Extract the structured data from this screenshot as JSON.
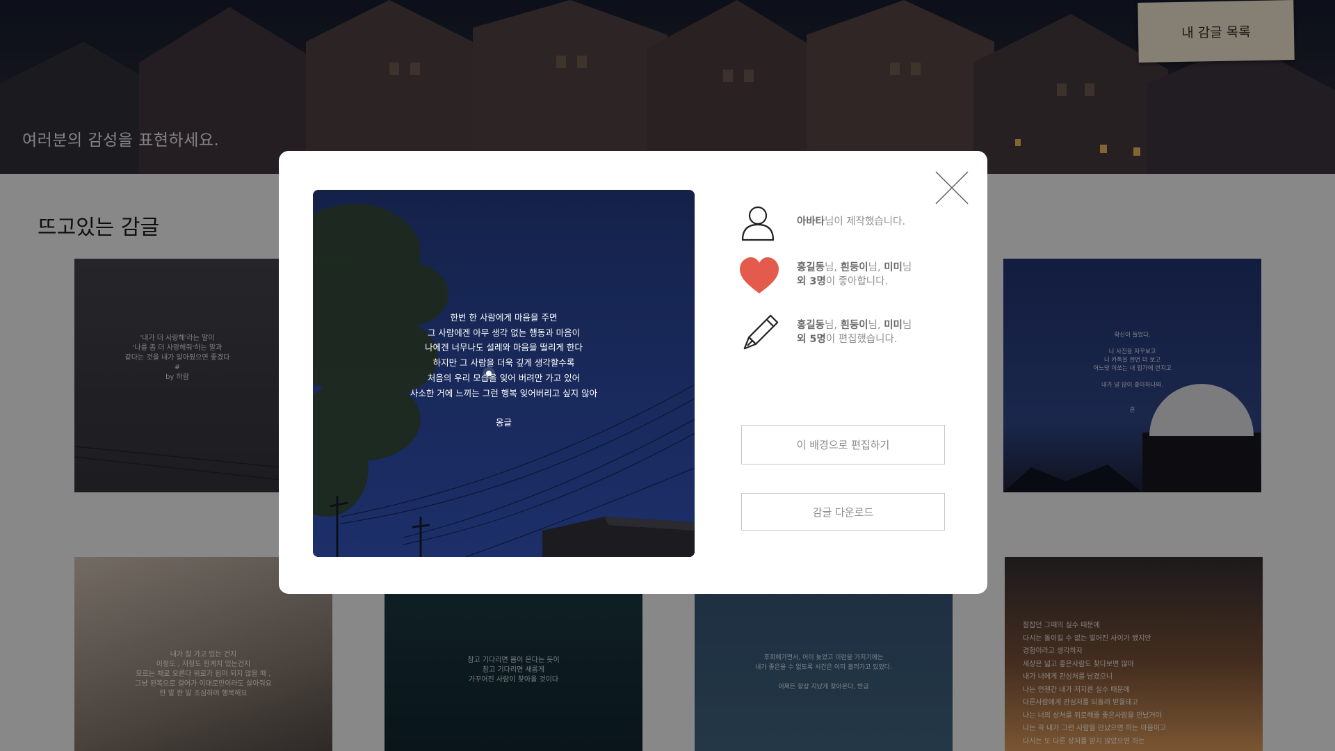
{
  "hero": {
    "tagline": "여러분의 감성을 표현하세요.",
    "my_list_button": "내 감글 목록"
  },
  "gallery": {
    "section_title": "뜨고있는 감글",
    "cards": [
      {
        "text": "'내가 더 사랑해'라는 말이\n'나를 좀 더 사랑해줘'하는 말과\n같다는 것을 내가 알아줬으면 좋겠다\n#\nby 하람"
      },
      {
        "text": "확신이 들었다.\n\n니 사진을 자꾸보고\n니 카톡을 한번 더 보고\n어느덧 이쏘는 내 입가에 번지고\n\n내가 널 많이 좋아하나봐.\n\n\n혼"
      },
      {
        "text": "내가 잘 가고 있는 건지\n이정도 , 저정도 한계치 있는건지\n모르는 채로 오른다 위로가 됩이 되지 않을 때 ,\n그냥 왼쪽으로 걸어가 이대로만이라도 살아줘요\n한 발 한 발 조심하며 행복해요"
      },
      {
        "text": "참고 기다리면 봄이 온다는 듯이\n참고 기다리면 새롭게\n가꾸어진 사람이 찾아올 것이다"
      },
      {
        "text": "후회해가면서, 어이 늦었고 이런을 가지기에는\n내가 좋은을 수 없도록 시간은 이미 흘러가고 있었다.\n\n어쩌든 항상 지났게 찾아온다, 반금"
      },
      {
        "text": "잘잡던 그때의 실수 때문에\n다시는 돌이킬 수 없는 멀어진 사이가 됐지만\n경험이라고 생각하자\n세상은 넓고 좋은사람도 찾다보면 많아\n내가 너에게 관심처를 남겼으니\n나는 언젠간 내가 저지른 실수 때문에\n다른사람에게 관심처를 되돌려 받을테고\n나는 너의 상처를 위로해줄 좋은사람을 만났거야\n나는 꼭 내가 그런 사람을 만났으면 하는 마음이고\n다시는 또 다른 상처를 받지 않았으면 하는"
      }
    ]
  },
  "modal": {
    "poem_lines": [
      "한번 한 사람에게 마음을 주면",
      "그 사람에겐 아무 생각 없는 행동과 마음이",
      "나에겐 너무나도 설레와 마음을 떨리게 한다",
      "하지만 그 사람을 더욱 깊게 생각할수록",
      "처음의 우리 모습을 잊어 버려만 가고 있어",
      "사소한 거에 느끼는 그런 행복 잊어버리고 싶지 않아"
    ],
    "poem_signature": "옹글",
    "creator": {
      "name": "아바타",
      "suffix": "님이 제작했습니다."
    },
    "likes": {
      "n1": "홍길동",
      "n2": "흰둥이",
      "n3": "미미",
      "nim": "님",
      "sep": ", ",
      "others": "외 3명",
      "suffix": "이 좋아합니다."
    },
    "edits": {
      "n1": "홍길동",
      "n2": "흰둥이",
      "n3": "미미",
      "nim": "님",
      "sep": ", ",
      "others": "외 5명",
      "suffix": "이 편집했습니다."
    },
    "edit_button": "이 배경으로 편집하기",
    "download_button": "감글 다운로드"
  },
  "icons": {
    "close": "close-icon",
    "user": "user-icon",
    "like": "heart-icon",
    "edit": "pencil-icon"
  },
  "colors": {
    "heart": "#e45a4c",
    "modal_bg": "#ffffff",
    "button_border": "#c8c8c8",
    "night_sky": "#16254f"
  }
}
